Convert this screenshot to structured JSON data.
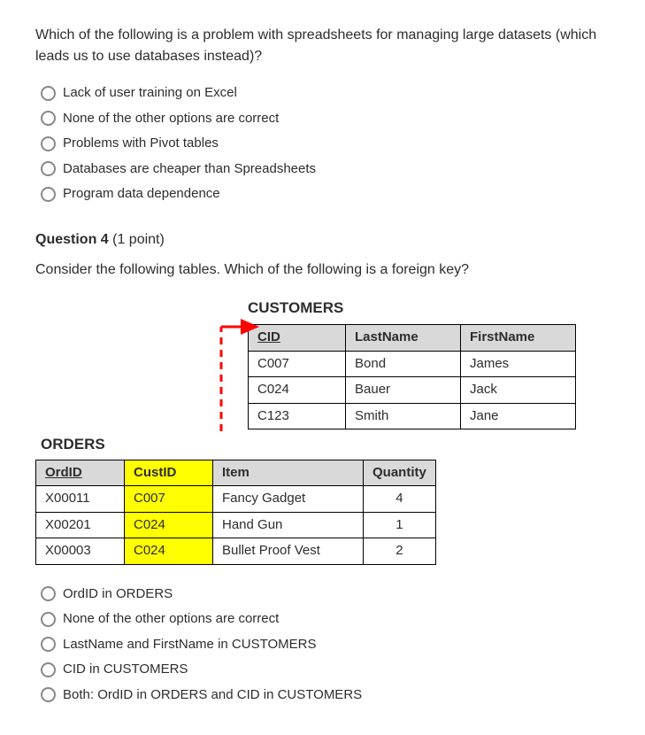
{
  "q1": {
    "text": "Which of the following is a problem with spreadsheets for managing large datasets (which leads us to use databases instead)?",
    "options": [
      "Lack of user training on Excel",
      "None of the other options are correct",
      "Problems with Pivot tables",
      "Databases are cheaper than Spreadsheets",
      "Program data dependence"
    ]
  },
  "q2": {
    "header_num": "Question 4",
    "header_points": " (1 point)",
    "text": "Consider the following tables. Which of the following is a foreign key?",
    "customers_title": "CUSTOMERS",
    "customers_headers": [
      "CID",
      "LastName",
      "FirstName"
    ],
    "customers_rows": [
      [
        "C007",
        "Bond",
        "James"
      ],
      [
        "C024",
        "Bauer",
        "Jack"
      ],
      [
        "C123",
        "Smith",
        "Jane"
      ]
    ],
    "orders_title": "ORDERS",
    "orders_headers": [
      "OrdID",
      "CustID",
      "Item",
      "Quantity"
    ],
    "orders_rows": [
      [
        "X00011",
        "C007",
        "Fancy Gadget",
        "4"
      ],
      [
        "X00201",
        "C024",
        "Hand Gun",
        "1"
      ],
      [
        "X00003",
        "C024",
        "Bullet Proof Vest",
        "2"
      ]
    ],
    "options": [
      "OrdID in ORDERS",
      "None of the other options are correct",
      "LastName and FirstName in CUSTOMERS",
      "CID in CUSTOMERS",
      "Both: OrdID in ORDERS and CID in CUSTOMERS"
    ]
  }
}
